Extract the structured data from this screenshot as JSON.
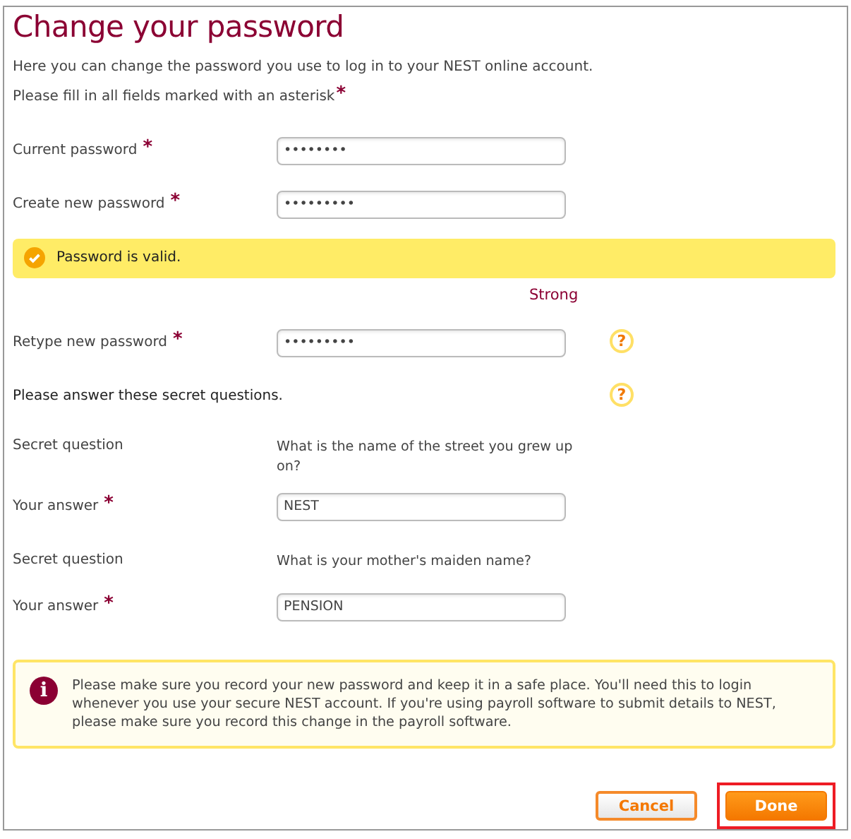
{
  "title": "Change your password",
  "intro": "Here you can change the password you use to log in to your NEST online account.",
  "required_note": {
    "text": "Please fill in all fields marked with an asterisk",
    "asterisk": "*"
  },
  "rows": [
    {
      "kind": "input",
      "label": "Current password",
      "asterisk": "*",
      "value": "••••••••"
    },
    {
      "kind": "input",
      "label": "Create new password",
      "asterisk": "*",
      "value": "•••••••••"
    },
    {
      "kind": "validation",
      "text": "Password is valid."
    },
    {
      "kind": "strength",
      "text": "Strong"
    },
    {
      "kind": "input",
      "label": "Retype new password",
      "asterisk": "*",
      "value": "•••••••••",
      "help_glyph": "?"
    },
    {
      "kind": "heading",
      "text": "Please answer these secret questions.",
      "help_glyph": "?"
    },
    {
      "kind": "question",
      "label": "Secret question",
      "text": "What is the name of the street you grew up on?"
    },
    {
      "kind": "input",
      "label": "Your answer",
      "asterisk": "*",
      "value": "NEST"
    },
    {
      "kind": "question",
      "label": "Secret question",
      "text": "What is your mother's maiden name?"
    },
    {
      "kind": "input",
      "label": "Your answer",
      "asterisk": "*",
      "value": "PENSION"
    }
  ],
  "info": {
    "glyph": "i",
    "text": "Please make sure you record your new password and keep it in a safe place. You'll need this to login whenever you use your secure NEST account. If you're using payroll software to submit details to NEST, please make sure you record this change in the payroll software."
  },
  "buttons": [
    {
      "kind": "secondary",
      "label": "Cancel",
      "highlighted": false
    },
    {
      "kind": "primary",
      "label": "Done",
      "highlighted": true
    }
  ]
}
